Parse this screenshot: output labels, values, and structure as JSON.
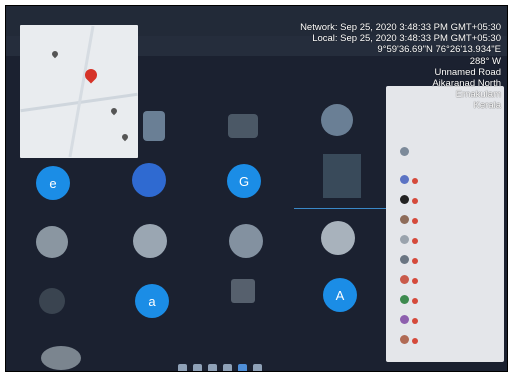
{
  "overlay": {
    "network": "Network: Sep 25, 2020 3:48:33 PM GMT+05:30",
    "local": "Local: Sep 25, 2020 3:48:33 PM GMT+05:30",
    "coords": "9°59'36.69\"N 76°26'13.934\"E",
    "heading": "288° W",
    "road": "Unnamed Road",
    "area": "Aikaranad North",
    "district": "Ernakulam",
    "state": "Kerala"
  },
  "tiles": [
    {
      "letter": "e"
    },
    {
      "letter": "G"
    },
    {
      "letter": "a"
    },
    {
      "letter": "A"
    }
  ],
  "colors": {
    "accent": "#1b8de6",
    "mute_red": "#d54a3b",
    "panel_bg": "#e4e6ea",
    "map_pin": "#d63328"
  }
}
